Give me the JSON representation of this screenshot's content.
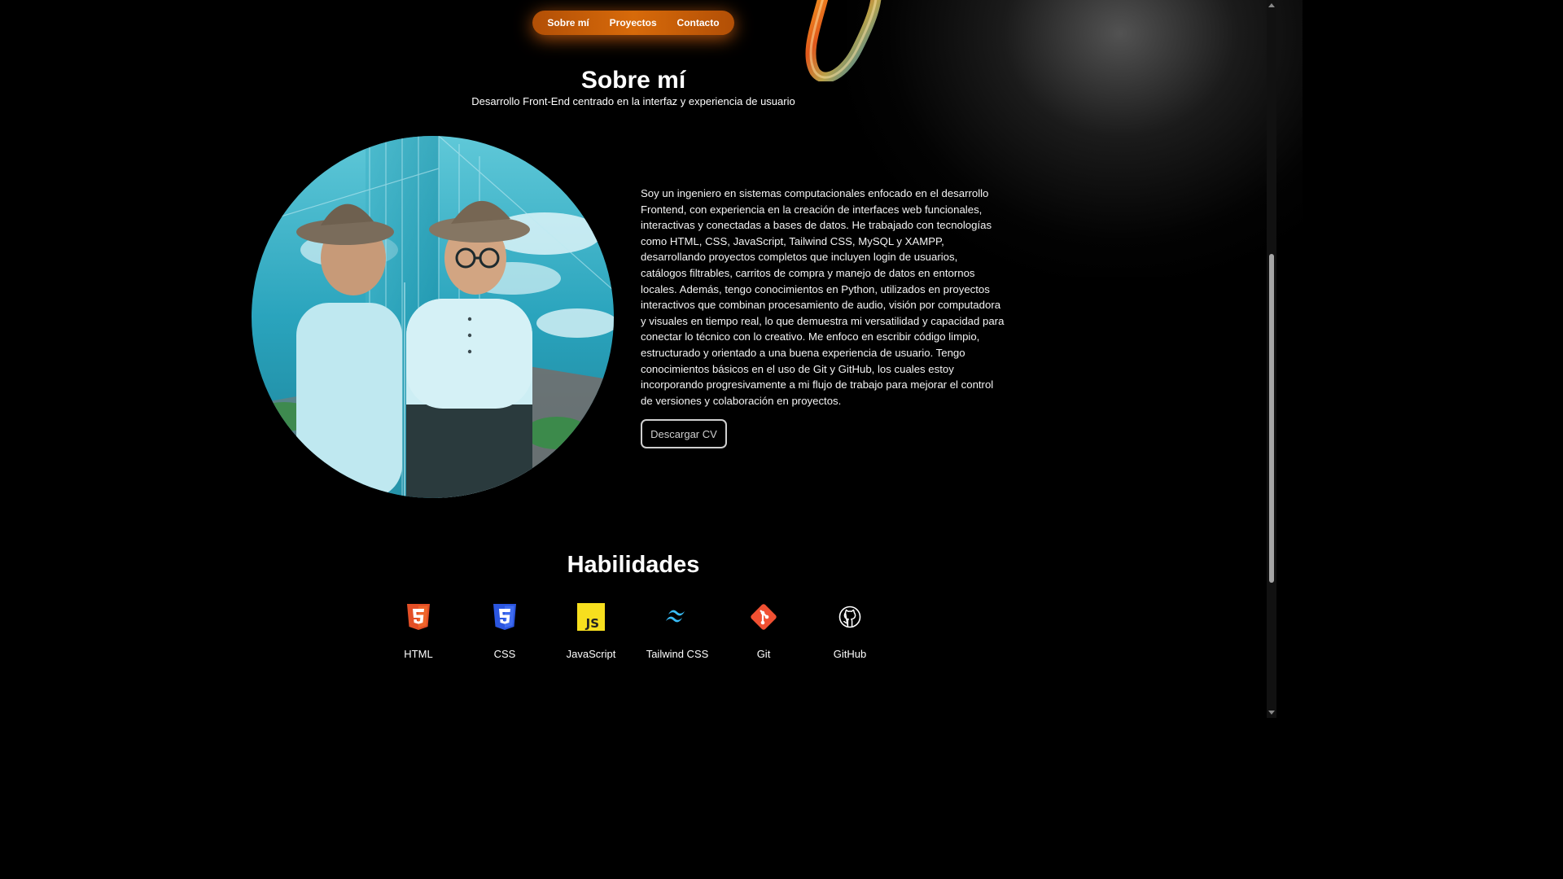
{
  "nav": {
    "items": [
      {
        "label": "Sobre mí"
      },
      {
        "label": "Proyectos"
      },
      {
        "label": "Contacto"
      }
    ]
  },
  "about": {
    "title": "Sobre mí",
    "subtitle": "Desarrollo Front-End centrado en la interfaz y experiencia de usuario",
    "paragraph": "Soy un ingeniero en sistemas computacionales enfocado en el desarrollo Frontend, con experiencia en la creación de interfaces web funcionales, interactivas y conectadas a bases de datos. He trabajado con tecnologías como HTML, CSS, JavaScript, Tailwind CSS, MySQL y XAMPP, desarrollando proyectos completos que incluyen login de usuarios, catálogos filtrables, carritos de compra y manejo de datos en entornos locales. Además, tengo conocimientos en Python, utilizados en proyectos interactivos que combinan procesamiento de audio, visión por computadora y visuales en tiempo real, lo que demuestra mi versatilidad y capacidad para conectar lo técnico con lo creativo. Me enfoco en escribir código limpio, estructurado y orientado a una buena experiencia de usuario. Tengo conocimientos básicos en el uso de Git y GitHub, los cuales estoy incorporando progresivamente a mi flujo de trabajo para mejorar el control de versiones y colaboración en proyectos.",
    "cv_button": "Descargar CV"
  },
  "skills": {
    "title": "Habilidades",
    "items": [
      {
        "label": "HTML",
        "icon": "html5-icon",
        "color": "#e34f26"
      },
      {
        "label": "CSS",
        "icon": "css3-icon",
        "color": "#1572b6"
      },
      {
        "label": "JavaScript",
        "icon": "javascript-icon",
        "color": "#f7df1e"
      },
      {
        "label": "Tailwind CSS",
        "icon": "tailwind-icon",
        "color": "#38bdf8"
      },
      {
        "label": "Git",
        "icon": "git-icon",
        "color": "#f05032"
      },
      {
        "label": "GitHub",
        "icon": "github-icon",
        "color": "#ffffff"
      }
    ]
  },
  "colors": {
    "background": "#000000",
    "nav_accent": "#d76a0a"
  }
}
